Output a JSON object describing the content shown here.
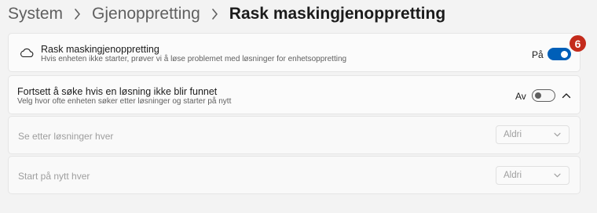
{
  "breadcrumb": {
    "items": [
      "System",
      "Gjenoppretting"
    ],
    "current": "Rask maskingjenoppretting"
  },
  "quick_recovery": {
    "title": "Rask maskingjenoppretting",
    "subtitle": "Hvis enheten ikke starter, prøver vi å løse problemet med løsninger for enhetsoppretting",
    "state_label": "På",
    "toggle_on": true,
    "badge": "6"
  },
  "continue_search": {
    "title": "Fortsett å søke hvis en løsning ikke blir funnet",
    "subtitle": "Velg hvor ofte enheten søker etter løsninger og starter på nytt",
    "state_label": "Av",
    "toggle_on": false
  },
  "check_interval": {
    "label": "Se etter løsninger hver",
    "value": "Aldri"
  },
  "restart_interval": {
    "label": "Start på nytt hver",
    "value": "Aldri"
  },
  "colors": {
    "accent": "#005fb8",
    "badge": "#c42b1c"
  }
}
